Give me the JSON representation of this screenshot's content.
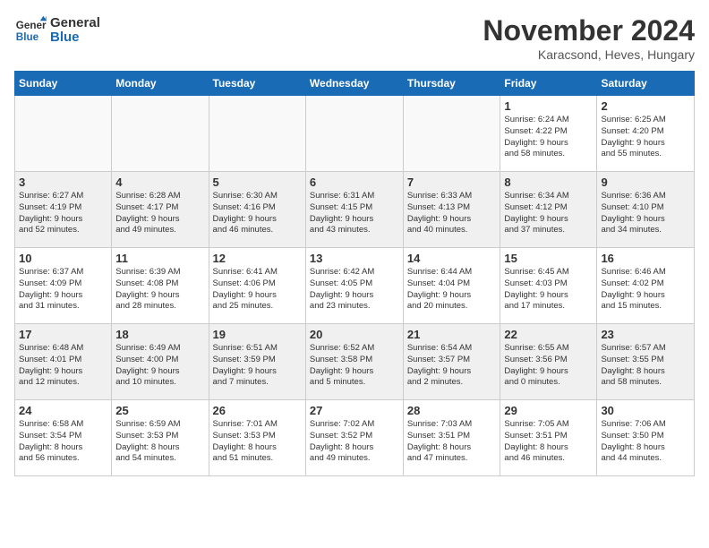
{
  "header": {
    "logo_line1": "General",
    "logo_line2": "Blue",
    "month": "November 2024",
    "location": "Karacsond, Heves, Hungary"
  },
  "weekdays": [
    "Sunday",
    "Monday",
    "Tuesday",
    "Wednesday",
    "Thursday",
    "Friday",
    "Saturday"
  ],
  "weeks": [
    {
      "shaded": false,
      "days": [
        {
          "num": "",
          "info": ""
        },
        {
          "num": "",
          "info": ""
        },
        {
          "num": "",
          "info": ""
        },
        {
          "num": "",
          "info": ""
        },
        {
          "num": "",
          "info": ""
        },
        {
          "num": "1",
          "info": "Sunrise: 6:24 AM\nSunset: 4:22 PM\nDaylight: 9 hours\nand 58 minutes."
        },
        {
          "num": "2",
          "info": "Sunrise: 6:25 AM\nSunset: 4:20 PM\nDaylight: 9 hours\nand 55 minutes."
        }
      ]
    },
    {
      "shaded": true,
      "days": [
        {
          "num": "3",
          "info": "Sunrise: 6:27 AM\nSunset: 4:19 PM\nDaylight: 9 hours\nand 52 minutes."
        },
        {
          "num": "4",
          "info": "Sunrise: 6:28 AM\nSunset: 4:17 PM\nDaylight: 9 hours\nand 49 minutes."
        },
        {
          "num": "5",
          "info": "Sunrise: 6:30 AM\nSunset: 4:16 PM\nDaylight: 9 hours\nand 46 minutes."
        },
        {
          "num": "6",
          "info": "Sunrise: 6:31 AM\nSunset: 4:15 PM\nDaylight: 9 hours\nand 43 minutes."
        },
        {
          "num": "7",
          "info": "Sunrise: 6:33 AM\nSunset: 4:13 PM\nDaylight: 9 hours\nand 40 minutes."
        },
        {
          "num": "8",
          "info": "Sunrise: 6:34 AM\nSunset: 4:12 PM\nDaylight: 9 hours\nand 37 minutes."
        },
        {
          "num": "9",
          "info": "Sunrise: 6:36 AM\nSunset: 4:10 PM\nDaylight: 9 hours\nand 34 minutes."
        }
      ]
    },
    {
      "shaded": false,
      "days": [
        {
          "num": "10",
          "info": "Sunrise: 6:37 AM\nSunset: 4:09 PM\nDaylight: 9 hours\nand 31 minutes."
        },
        {
          "num": "11",
          "info": "Sunrise: 6:39 AM\nSunset: 4:08 PM\nDaylight: 9 hours\nand 28 minutes."
        },
        {
          "num": "12",
          "info": "Sunrise: 6:41 AM\nSunset: 4:06 PM\nDaylight: 9 hours\nand 25 minutes."
        },
        {
          "num": "13",
          "info": "Sunrise: 6:42 AM\nSunset: 4:05 PM\nDaylight: 9 hours\nand 23 minutes."
        },
        {
          "num": "14",
          "info": "Sunrise: 6:44 AM\nSunset: 4:04 PM\nDaylight: 9 hours\nand 20 minutes."
        },
        {
          "num": "15",
          "info": "Sunrise: 6:45 AM\nSunset: 4:03 PM\nDaylight: 9 hours\nand 17 minutes."
        },
        {
          "num": "16",
          "info": "Sunrise: 6:46 AM\nSunset: 4:02 PM\nDaylight: 9 hours\nand 15 minutes."
        }
      ]
    },
    {
      "shaded": true,
      "days": [
        {
          "num": "17",
          "info": "Sunrise: 6:48 AM\nSunset: 4:01 PM\nDaylight: 9 hours\nand 12 minutes."
        },
        {
          "num": "18",
          "info": "Sunrise: 6:49 AM\nSunset: 4:00 PM\nDaylight: 9 hours\nand 10 minutes."
        },
        {
          "num": "19",
          "info": "Sunrise: 6:51 AM\nSunset: 3:59 PM\nDaylight: 9 hours\nand 7 minutes."
        },
        {
          "num": "20",
          "info": "Sunrise: 6:52 AM\nSunset: 3:58 PM\nDaylight: 9 hours\nand 5 minutes."
        },
        {
          "num": "21",
          "info": "Sunrise: 6:54 AM\nSunset: 3:57 PM\nDaylight: 9 hours\nand 2 minutes."
        },
        {
          "num": "22",
          "info": "Sunrise: 6:55 AM\nSunset: 3:56 PM\nDaylight: 9 hours\nand 0 minutes."
        },
        {
          "num": "23",
          "info": "Sunrise: 6:57 AM\nSunset: 3:55 PM\nDaylight: 8 hours\nand 58 minutes."
        }
      ]
    },
    {
      "shaded": false,
      "days": [
        {
          "num": "24",
          "info": "Sunrise: 6:58 AM\nSunset: 3:54 PM\nDaylight: 8 hours\nand 56 minutes."
        },
        {
          "num": "25",
          "info": "Sunrise: 6:59 AM\nSunset: 3:53 PM\nDaylight: 8 hours\nand 54 minutes."
        },
        {
          "num": "26",
          "info": "Sunrise: 7:01 AM\nSunset: 3:53 PM\nDaylight: 8 hours\nand 51 minutes."
        },
        {
          "num": "27",
          "info": "Sunrise: 7:02 AM\nSunset: 3:52 PM\nDaylight: 8 hours\nand 49 minutes."
        },
        {
          "num": "28",
          "info": "Sunrise: 7:03 AM\nSunset: 3:51 PM\nDaylight: 8 hours\nand 47 minutes."
        },
        {
          "num": "29",
          "info": "Sunrise: 7:05 AM\nSunset: 3:51 PM\nDaylight: 8 hours\nand 46 minutes."
        },
        {
          "num": "30",
          "info": "Sunrise: 7:06 AM\nSunset: 3:50 PM\nDaylight: 8 hours\nand 44 minutes."
        }
      ]
    }
  ]
}
